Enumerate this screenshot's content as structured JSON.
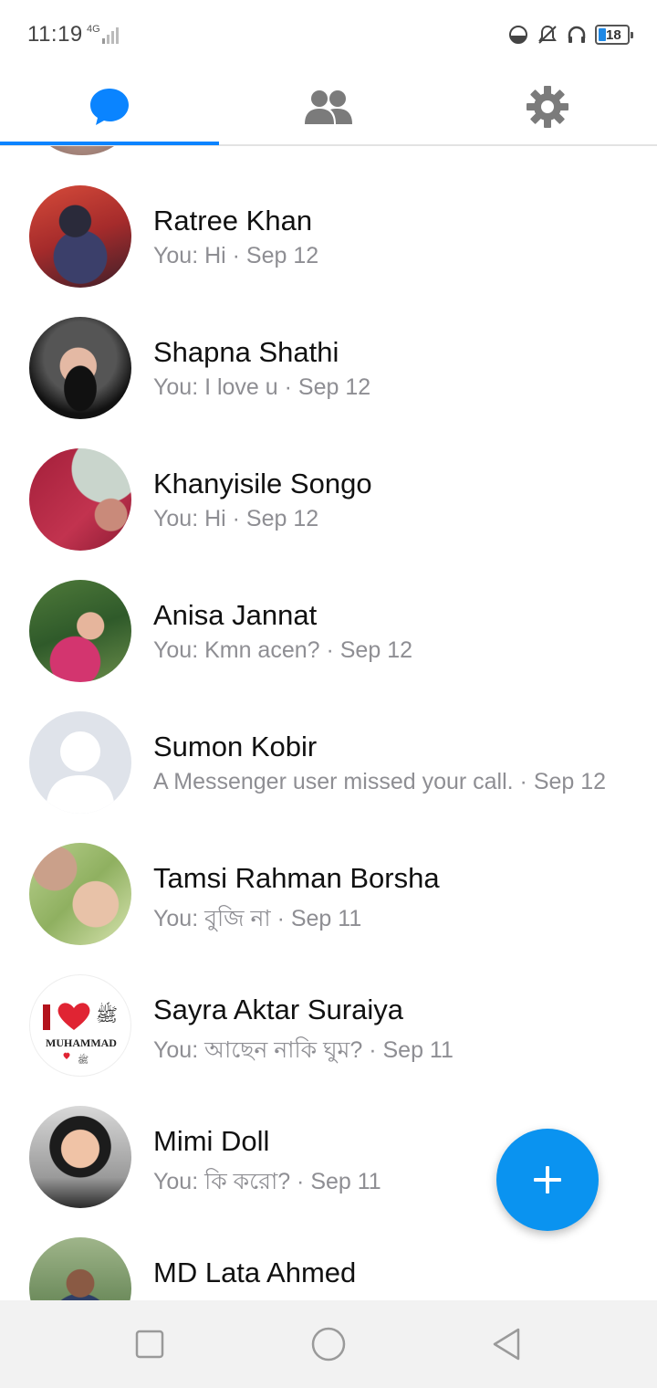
{
  "status_bar": {
    "time": "11:19",
    "network": "4G",
    "battery": "18",
    "icons": [
      "data-saver-icon",
      "bell-off-icon",
      "headphones-icon",
      "battery-icon"
    ]
  },
  "tabs": [
    {
      "name": "chats",
      "icon": "chat-bubble-icon",
      "active": true
    },
    {
      "name": "people",
      "icon": "people-icon",
      "active": false
    },
    {
      "name": "settings",
      "icon": "gear-icon",
      "active": false
    }
  ],
  "colors": {
    "accent": "#0a84ff",
    "fab": "#0a93f0",
    "secondary_text": "#8e8e93"
  },
  "conversations": [
    {
      "name": "Ratree Khan",
      "snippet": "You: Hi · Sep 12"
    },
    {
      "name": "Shapna Shathi",
      "snippet": "You: I love u · Sep 12"
    },
    {
      "name": "Khanyisile Songo",
      "snippet": "You: Hi · Sep 12"
    },
    {
      "name": "Anisa Jannat",
      "snippet": "You: Kmn acen? · Sep 12"
    },
    {
      "name": "Sumon Kobir",
      "snippet": "A Messenger user missed your call. · Sep 12"
    },
    {
      "name": "Tamsi Rahman Borsha",
      "snippet": "You: বুজি না · Sep 11"
    },
    {
      "name": "Sayra Aktar Suraiya",
      "snippet": "You: আছেন নাকি ঘুম? · Sep 11"
    },
    {
      "name": "Mimi Doll",
      "snippet": "You: কি করো? · Sep 11"
    },
    {
      "name": "MD Lata Ahmed",
      "snippet": ""
    }
  ],
  "avatar_logo_text": "MUHAMMAD",
  "fab": {
    "icon": "plus-icon"
  },
  "nav": {
    "buttons": [
      "recents-icon",
      "home-icon",
      "back-icon"
    ]
  }
}
